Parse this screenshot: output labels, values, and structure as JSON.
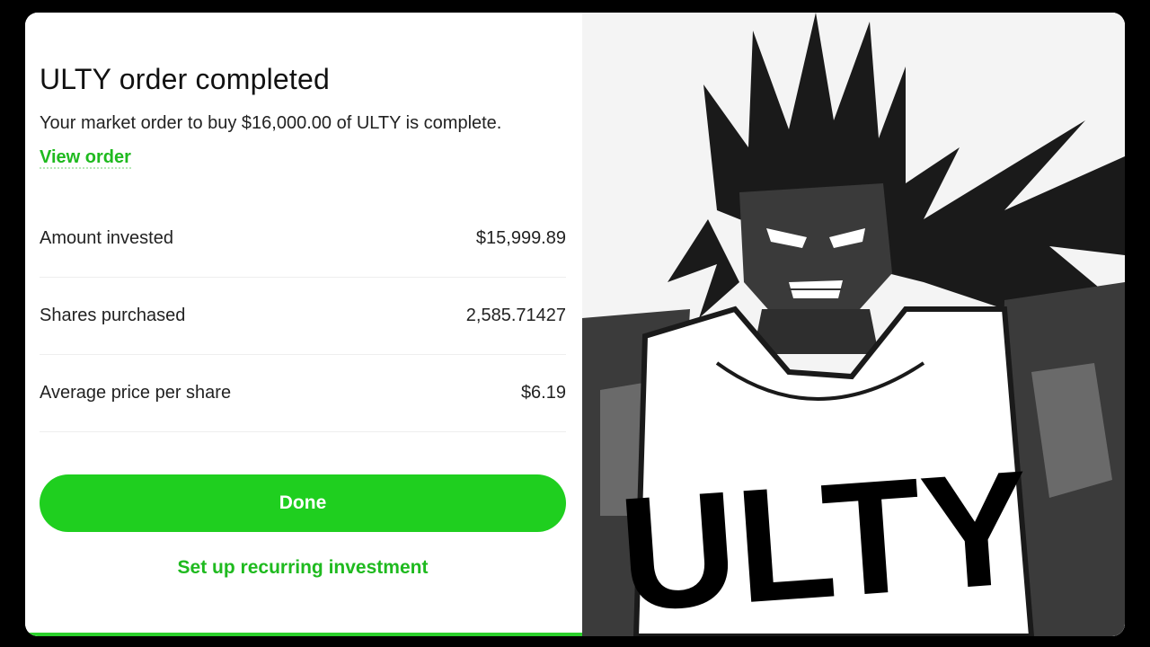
{
  "order": {
    "title": "ULTY order completed",
    "description": "Your market order to buy $16,000.00 of ULTY is complete.",
    "view_order_label": "View order",
    "details": [
      {
        "label": "Amount invested",
        "value": "$15,999.89"
      },
      {
        "label": "Shares purchased",
        "value": "2,585.71427"
      },
      {
        "label": "Average price per share",
        "value": "$6.19"
      }
    ],
    "done_label": "Done",
    "recurring_label": "Set up recurring investment"
  },
  "illustration": {
    "shirt_text": "ULTY"
  },
  "colors": {
    "accent_green": "#1fcf1f",
    "link_green": "#1fba1f"
  }
}
